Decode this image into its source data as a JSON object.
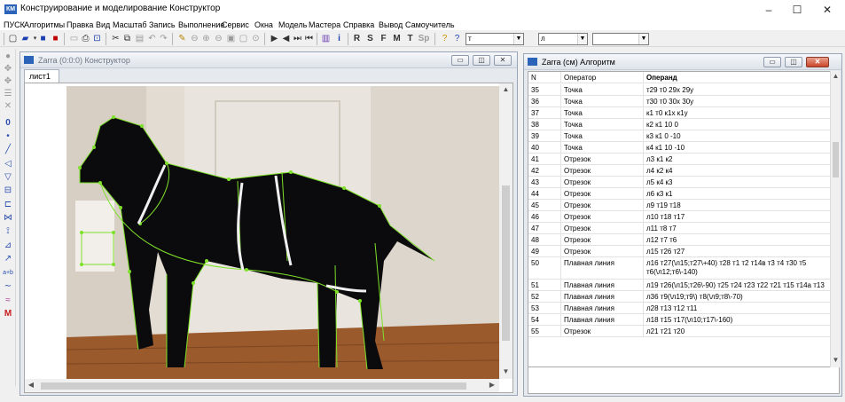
{
  "window": {
    "title": "Конструирование и моделирование Конструктор",
    "minimize": "–",
    "maximize": "☐",
    "close": "✕"
  },
  "menu": [
    "ПУСК",
    "Алгоритмы",
    "Правка",
    "Вид",
    "Масштаб",
    "Запись",
    "Выполнение",
    "Сервис",
    "Окна",
    "Модель",
    "Мастера",
    "Справка",
    "Вывод",
    "Самоучитель"
  ],
  "toolbar": {
    "letters": [
      "R",
      "S",
      "F",
      "M",
      "T",
      "Sp"
    ],
    "combo1_value": "т",
    "combo2_value": "л",
    "combo3_value": ""
  },
  "constructor_window": {
    "title": "Zarra (0:0:0) Конструктор",
    "sheet_tab": "лист1"
  },
  "algorithm_window": {
    "title": "Zarra (см) Алгоритм",
    "columns": [
      "N",
      "Оператор",
      "Операнд"
    ],
    "rows": [
      [
        "35",
        "Точка",
        "т29 т0 29х 29у"
      ],
      [
        "36",
        "Точка",
        "т30 т0 30х 30у"
      ],
      [
        "37",
        "Точка",
        "к1 т0 к1х к1у"
      ],
      [
        "38",
        "Точка",
        "к2 к1 10 0"
      ],
      [
        "39",
        "Точка",
        "к3 к1 0 -10"
      ],
      [
        "40",
        "Точка",
        "к4 к1 10 -10"
      ],
      [
        "41",
        "Отрезок",
        "л3 к1 к2"
      ],
      [
        "42",
        "Отрезок",
        "л4 к2 к4"
      ],
      [
        "43",
        "Отрезок",
        "л5 к4 к3"
      ],
      [
        "44",
        "Отрезок",
        "л6 к3 к1"
      ],
      [
        "45",
        "Отрезок",
        "л9 т19 т18"
      ],
      [
        "46",
        "Отрезок",
        "л10 т18 т17"
      ],
      [
        "47",
        "Отрезок",
        "л11 т8 т7"
      ],
      [
        "48",
        "Отрезок",
        "л12 т7 т6"
      ],
      [
        "49",
        "Отрезок",
        "л15 т26 т27"
      ],
      [
        "50",
        "Плавная линия",
        "л16 т27(\\л15;т27\\+40) т28 т1 т2 т14в т3 т4 т30 т5 т6(\\л12;т6\\-140)"
      ],
      [
        "51",
        "Плавная линия",
        "л19 т26(\\л15;т26\\-90) т25 т24 т23 т22 т21 т15 т14а т13 т11"
      ],
      [
        "52",
        "Плавная линия",
        "л36 т9(\\л19;т9\\) т8(\\л9;т8\\-70)"
      ],
      [
        "53",
        "Плавная линия",
        "л28 т13 т12 т11"
      ],
      [
        "54",
        "Плавная линия",
        "л18 т15 т17(\\л10;т17\\-160)"
      ],
      [
        "55",
        "Отрезок",
        "л21 т21 т20"
      ]
    ]
  },
  "colors": {
    "outline": "#7ee02a",
    "dog": "#0b0b0d",
    "door": "#e7e3db",
    "floor": "#9a5a2c",
    "wall": "#e3dcd2",
    "accent_blue": "#2a63b8"
  }
}
